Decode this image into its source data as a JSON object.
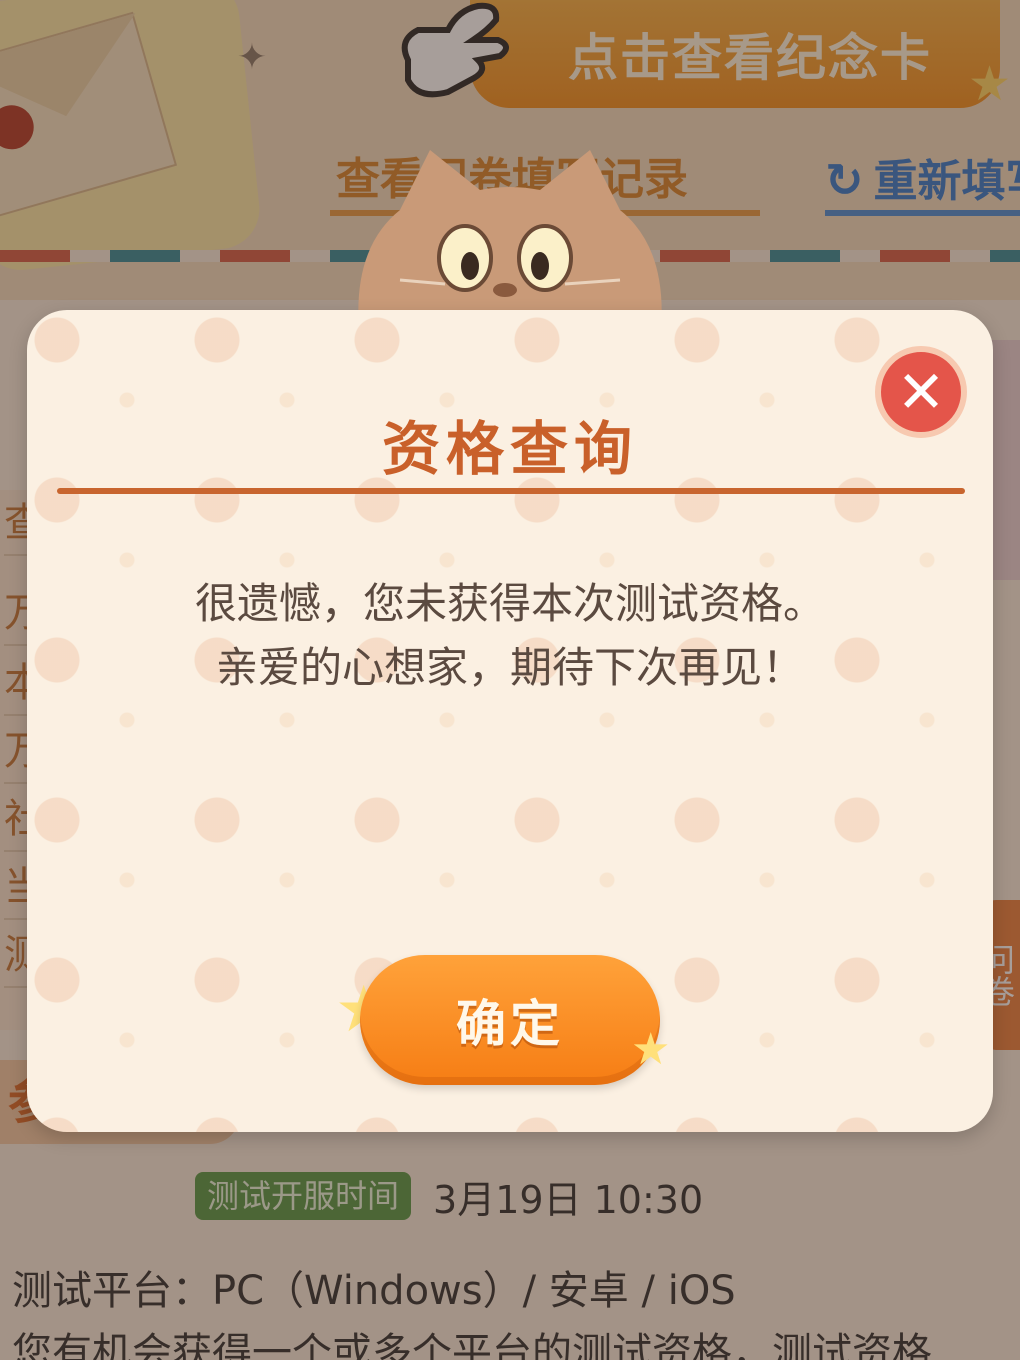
{
  "background": {
    "memorial_button_label": "点击查看纪念卡",
    "link_record": "查看问卷填写记录",
    "link_refresh": "重新填写",
    "left_panel_rows": [
      "查",
      "万",
      "本",
      "万",
      "社",
      "当",
      "测"
    ],
    "right_tab_text": "问卷",
    "section_tag": "参",
    "test_time_badge": "测试开服时间",
    "test_time_value": "3月19日  10:30",
    "platform_line": "测试平台：PC（Windows）/ 安卓 / iOS",
    "description_line": "您有机会获得一个或多个平台的测试资格，测试资格"
  },
  "modal": {
    "title": "资格查询",
    "message_line1": "很遗憾，您未获得本次测试资格。",
    "message_line2": "亲爱的心想家，期待下次再见！",
    "confirm_label": "确定",
    "close_icon": "close-icon"
  },
  "colors": {
    "accent_orange": "#f67d14",
    "title_brown": "#c9602a",
    "close_red": "#e4554a",
    "badge_green": "#5a9a4a"
  }
}
